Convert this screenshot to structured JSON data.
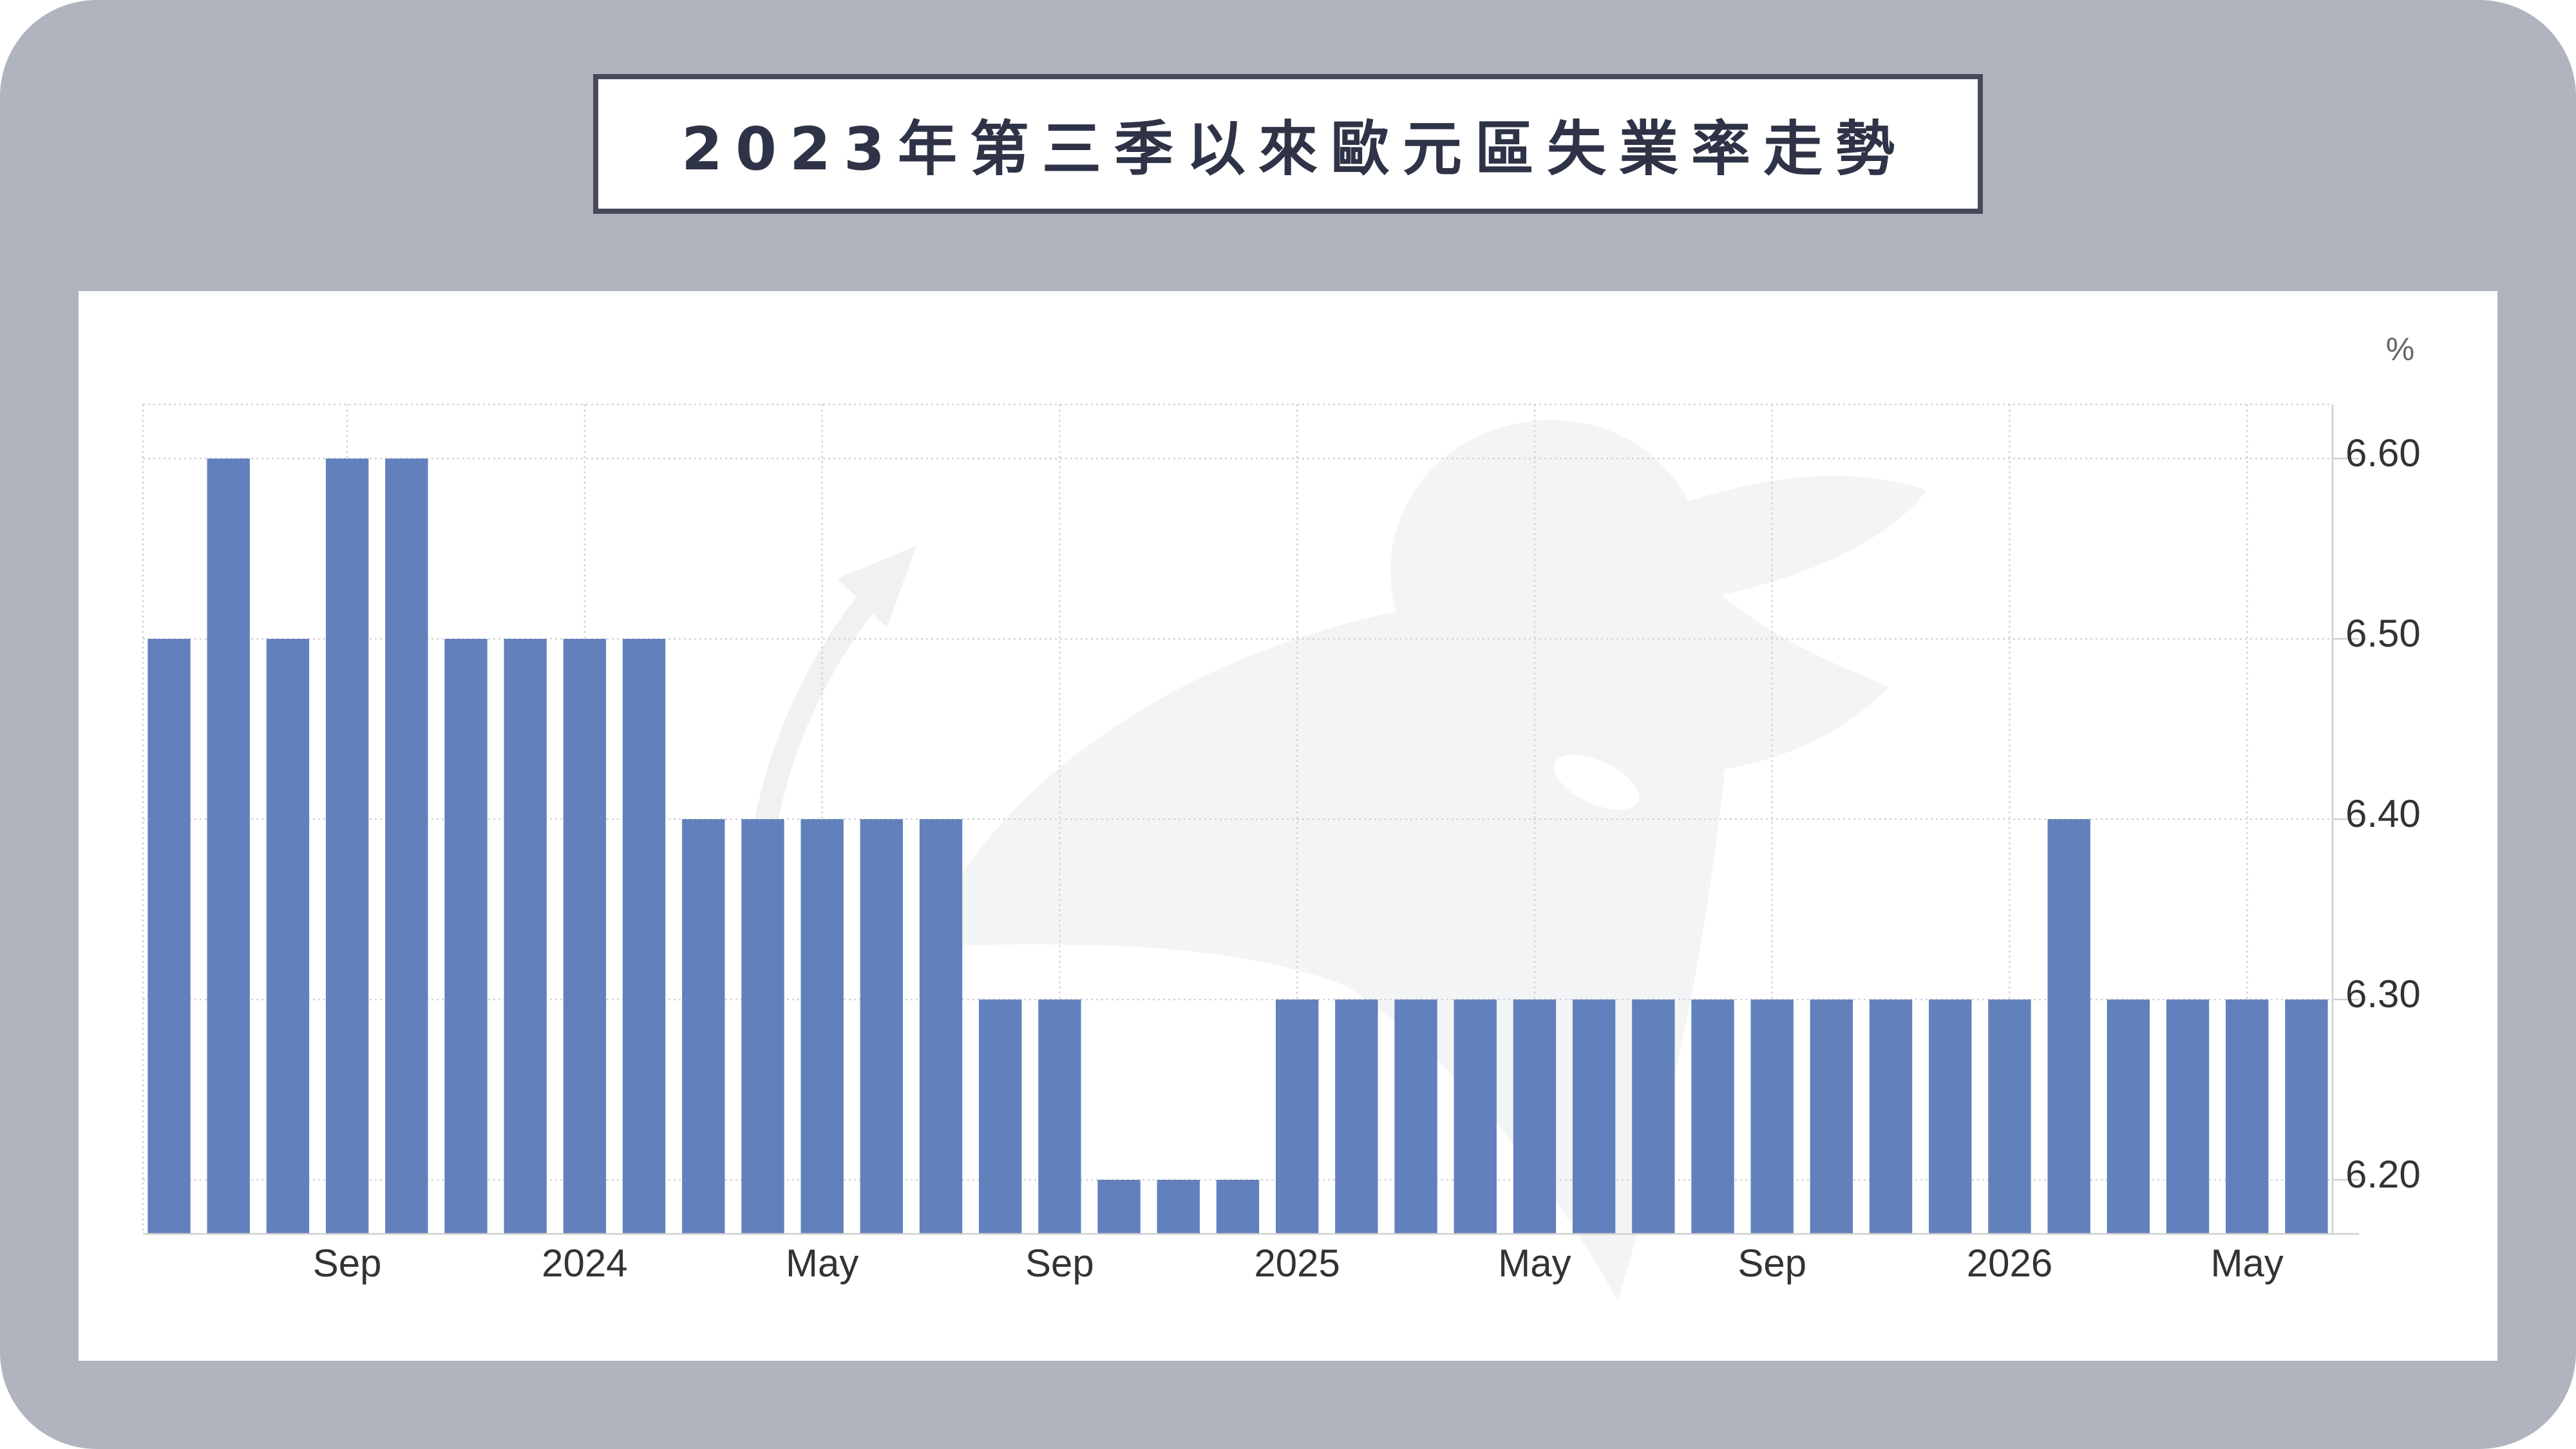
{
  "colors": {
    "frame": "#b0b4bf",
    "bar": "#6281bc",
    "title_text": "#2f3347"
  },
  "chart_data": {
    "type": "bar",
    "title": "2023年第三季以來歐元區失業率走勢",
    "unit": "%",
    "x": [
      "2023-06",
      "2023-07",
      "2023-08",
      "2023-09",
      "2023-10",
      "2023-11",
      "2023-12",
      "2024-01",
      "2024-02",
      "2024-03",
      "2024-04",
      "2024-05",
      "2024-06",
      "2024-07",
      "2024-08",
      "2024-09",
      "2024-10",
      "2024-11",
      "2024-12",
      "2025-01",
      "2025-02",
      "2025-03",
      "2025-04",
      "2025-05",
      "2025-06",
      "2025-07",
      "2025-08",
      "2025-09",
      "2025-10",
      "2025-11",
      "2025-12",
      "2026-01",
      "2026-02",
      "2026-03",
      "2026-04",
      "2026-05",
      "2026-06"
    ],
    "values": [
      6.5,
      6.6,
      6.5,
      6.6,
      6.6,
      6.5,
      6.5,
      6.5,
      6.5,
      6.4,
      6.4,
      6.4,
      6.4,
      6.4,
      6.3,
      6.3,
      6.2,
      6.2,
      6.2,
      6.3,
      6.3,
      6.3,
      6.3,
      6.3,
      6.3,
      6.3,
      6.3,
      6.3,
      6.3,
      6.3,
      6.3,
      6.3,
      6.4,
      6.3,
      6.3,
      6.3,
      6.3
    ],
    "x_ticks": [
      {
        "label": "Sep",
        "at": "2023-09"
      },
      {
        "label": "2024",
        "at": "2024-01"
      },
      {
        "label": "May",
        "at": "2024-05"
      },
      {
        "label": "Sep",
        "at": "2024-09"
      },
      {
        "label": "2025",
        "at": "2025-01"
      },
      {
        "label": "May",
        "at": "2025-05"
      },
      {
        "label": "Sep",
        "at": "2025-09"
      },
      {
        "label": "2026",
        "at": "2026-01"
      },
      {
        "label": "May",
        "at": "2026-05"
      }
    ],
    "y_ticks": [
      "6.60",
      "6.50",
      "6.40",
      "6.30",
      "6.20"
    ],
    "ylim": [
      6.17,
      6.63
    ],
    "y_axis_side": "right",
    "grid": true,
    "legend": false
  }
}
